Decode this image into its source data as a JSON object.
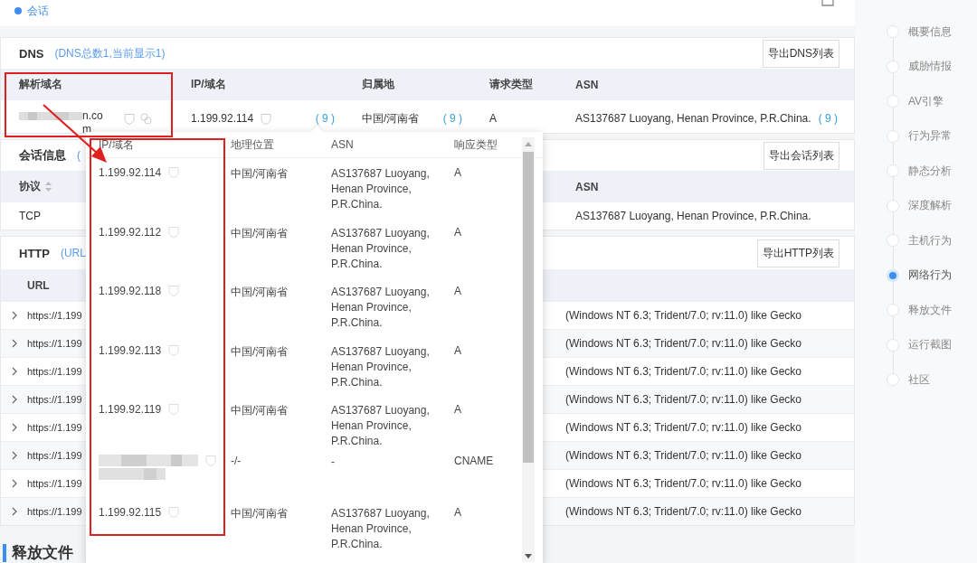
{
  "session_tab": {
    "label": "会话"
  },
  "dns": {
    "title": "DNS",
    "subtitle": "(DNS总数1,当前显示1)",
    "export_button": "导出DNS列表",
    "columns": [
      "解析域名",
      "IP/域名",
      "归属地",
      "请求类型",
      "ASN"
    ],
    "rows": [
      {
        "domain_redacted": true,
        "domain": "n.com",
        "ip": "1.199.92.114",
        "ip_count": "( 9 )",
        "location": "中国/河南省",
        "location_count": "( 9 )",
        "type": "A",
        "asn": "AS137687 Luoyang, Henan Province, P.R.China.",
        "asn_count": "( 9 )"
      }
    ]
  },
  "sessions": {
    "title": "会话信息",
    "subtitle": "(",
    "export_button": "导出会话列表",
    "columns": [
      "协议",
      "ASN"
    ],
    "rows": [
      {
        "protocol": "TCP",
        "asn": "AS137687 Luoyang, Henan Province, P.R.China."
      }
    ]
  },
  "http": {
    "title": "HTTP",
    "subtitle": "(URL",
    "export_button": "导出HTTP列表",
    "columns": [
      "URL"
    ],
    "rows": [
      {
        "url": "https://1.199",
        "user_agent": "(Windows NT 6.3; Trident/7.0; rv:11.0) like Gecko"
      },
      {
        "url": "https://1.199",
        "user_agent": "(Windows NT 6.3; Trident/7.0; rv:11.0) like Gecko"
      },
      {
        "url": "https://1.199",
        "user_agent": "(Windows NT 6.3; Trident/7.0; rv:11.0) like Gecko"
      },
      {
        "url": "https://1.199",
        "user_agent": "(Windows NT 6.3; Trident/7.0; rv:11.0) like Gecko"
      },
      {
        "url": "https://1.199",
        "user_agent": "(Windows NT 6.3; Trident/7.0; rv:11.0) like Gecko"
      },
      {
        "url": "https://1.199",
        "user_agent": "(Windows NT 6.3; Trident/7.0; rv:11.0) like Gecko"
      },
      {
        "url": "https://1.199",
        "user_agent": "(Windows NT 6.3; Trident/7.0; rv:11.0) like Gecko"
      },
      {
        "url": "https://1.199",
        "user_agent": "(Windows NT 6.3; Trident/7.0; rv:11.0) like Gecko"
      }
    ]
  },
  "next_section": {
    "title": "释放文件"
  },
  "popover": {
    "columns": [
      "IP/域名",
      "地理位置",
      "ASN",
      "响应类型"
    ],
    "rows": [
      {
        "kind": "ip",
        "host": "1.199.92.114",
        "location": "中国/河南省",
        "asn": "AS137687 Luoyang, Henan Province, P.R.China.",
        "type": "A"
      },
      {
        "kind": "ip",
        "host": "1.199.92.112",
        "location": "中国/河南省",
        "asn": "AS137687 Luoyang, Henan Province, P.R.China.",
        "type": "A"
      },
      {
        "kind": "ip",
        "host": "1.199.92.118",
        "location": "中国/河南省",
        "asn": "AS137687 Luoyang, Henan Province, P.R.China.",
        "type": "A"
      },
      {
        "kind": "ip",
        "host": "1.199.92.113",
        "location": "中国/河南省",
        "asn": "AS137687 Luoyang, Henan Province, P.R.China.",
        "type": "A"
      },
      {
        "kind": "ip",
        "host": "1.199.92.119",
        "location": "中国/河南省",
        "asn": "AS137687 Luoyang, Henan Province, P.R.China.",
        "type": "A"
      },
      {
        "kind": "redacted",
        "location": "-/-",
        "asn": "-",
        "type": "CNAME"
      },
      {
        "kind": "ip",
        "host": "1.199.92.115",
        "location": "中国/河南省",
        "asn": "AS137687 Luoyang, Henan Province, P.R.China.",
        "type": "A"
      }
    ]
  },
  "nav": [
    {
      "label": "概要信息",
      "selected": false
    },
    {
      "label": "威胁情报",
      "selected": false
    },
    {
      "label": "AV引擎",
      "selected": false
    },
    {
      "label": "行为异常",
      "selected": false
    },
    {
      "label": "静态分析",
      "selected": false
    },
    {
      "label": "深度解析",
      "selected": false
    },
    {
      "label": "主机行为",
      "selected": false
    },
    {
      "label": "网络行为",
      "selected": true
    },
    {
      "label": "释放文件",
      "selected": false
    },
    {
      "label": "运行截图",
      "selected": false
    },
    {
      "label": "社区",
      "selected": false
    }
  ]
}
